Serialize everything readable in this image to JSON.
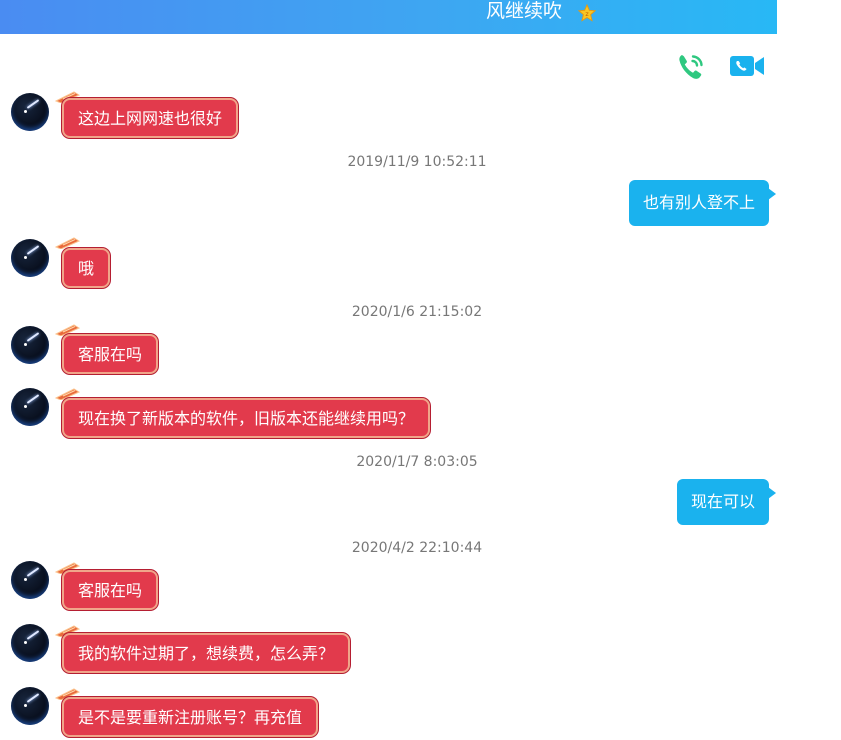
{
  "header": {
    "title": "风继续吹"
  },
  "colors": {
    "header_start": "#4a8cf2",
    "header_end": "#28b8f5",
    "incoming_bubble": "#e23a4c",
    "outgoing_bubble": "#1ab2ee",
    "call_icon": "#2fc880",
    "video_icon": "#1ab2ee"
  },
  "actions": {
    "call_icon": "phone-call-icon",
    "video_icon": "video-call-icon"
  },
  "messages": [
    {
      "direction": "incoming",
      "text": "这边上网网速也很好"
    },
    {
      "timestamp": "2019/11/9 10:52:11"
    },
    {
      "direction": "outgoing",
      "text": "也有别人登不上"
    },
    {
      "direction": "incoming",
      "text": "哦"
    },
    {
      "timestamp": "2020/1/6 21:15:02"
    },
    {
      "direction": "incoming",
      "text": "客服在吗"
    },
    {
      "direction": "incoming",
      "text": "现在换了新版本的软件，旧版本还能继续用吗？"
    },
    {
      "timestamp": "2020/1/7 8:03:05"
    },
    {
      "direction": "outgoing",
      "text": "现在可以"
    },
    {
      "timestamp": "2020/4/2 22:10:44"
    },
    {
      "direction": "incoming",
      "text": "客服在吗"
    },
    {
      "direction": "incoming",
      "text": "我的软件过期了，想续费，怎么弄？"
    },
    {
      "direction": "incoming",
      "text": "是不是要重新注册账号？再充值"
    }
  ]
}
